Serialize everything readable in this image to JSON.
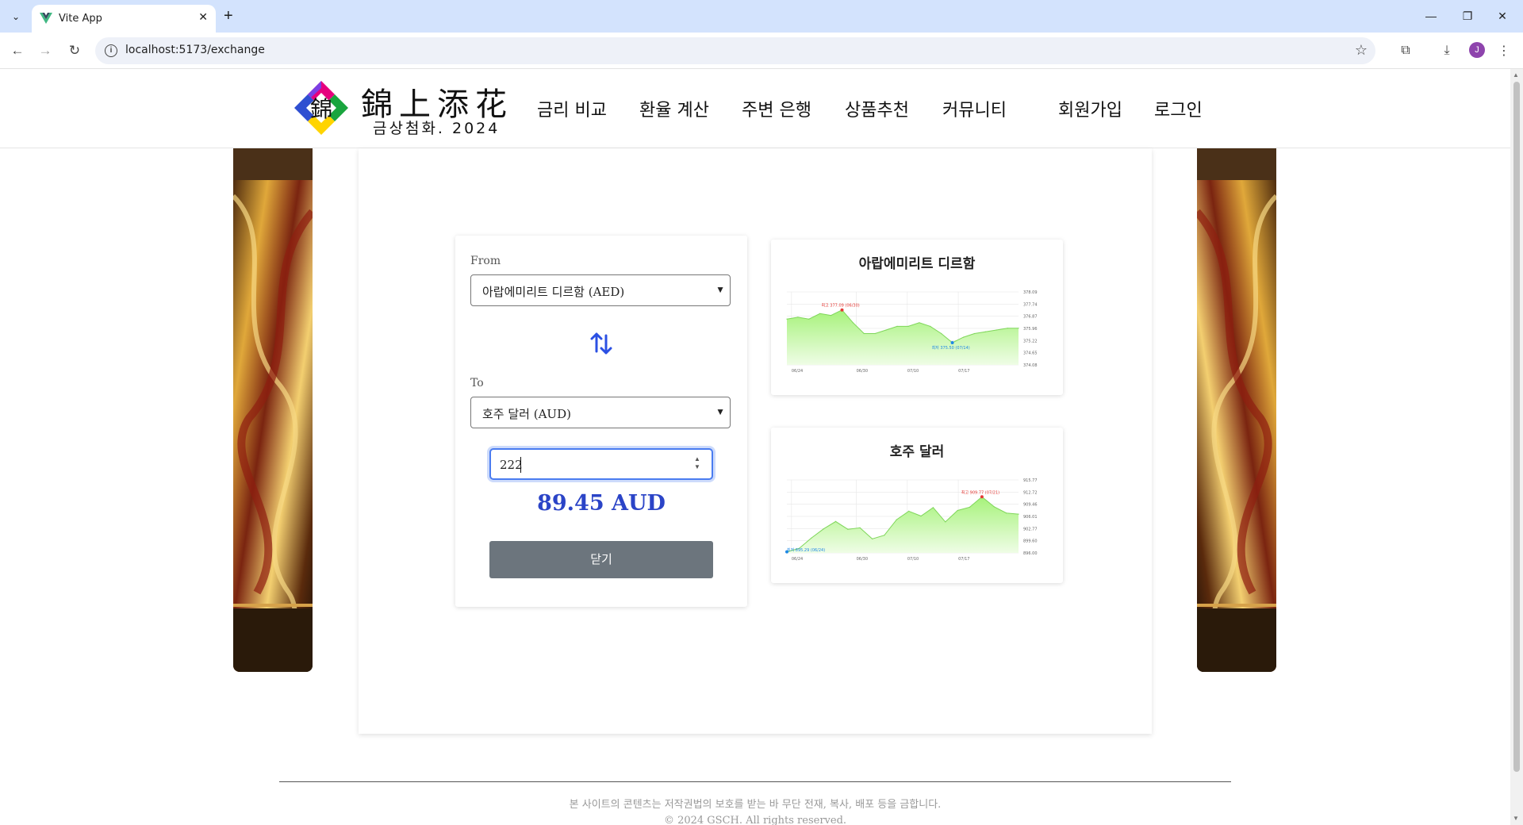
{
  "browser": {
    "tab_title": "Vite App",
    "url": "localhost:5173/exchange",
    "profile_initial": "J"
  },
  "site": {
    "brand_main": "錦上添花",
    "brand_sub": "금상첨화. 2024",
    "logo_char": "錦",
    "nav": [
      "금리 비교",
      "환율 계산",
      "주변 은행",
      "상품추천",
      "커뮤니티"
    ],
    "auth": [
      "회원가입",
      "로그인"
    ]
  },
  "converter": {
    "from_label": "From",
    "from_value": "아랍에미리트 디르함 (AED)",
    "to_label": "To",
    "to_value": "호주 달러 (AUD)",
    "amount": "222",
    "result": "89.45 AUD",
    "close_label": "닫기"
  },
  "charts": {
    "from_title": "아랍에미리트 디르함",
    "to_title": "호주 달러"
  },
  "chart_data": [
    {
      "type": "area",
      "title": "아랍에미리트 디르함",
      "x_ticks": [
        "06/24",
        "06/30",
        "07/10",
        "07/17"
      ],
      "y_ticks": [
        "378.09",
        "377.74",
        "376.87",
        "375.96",
        "375.22",
        "374.65",
        "374.08"
      ],
      "annotations": [
        "최고 377.09 (06/30)",
        "최저 375.50 (07/14)"
      ],
      "ylim": [
        374.08,
        378.09
      ],
      "series": [
        {
          "values": [
            376.6,
            376.7,
            376.6,
            376.9,
            376.8,
            377.1,
            376.4,
            375.8,
            375.8,
            376.0,
            376.2,
            376.2,
            376.4,
            376.2,
            375.8,
            375.3,
            375.6,
            375.8,
            375.9,
            376.0,
            376.1,
            376.1
          ]
        }
      ]
    },
    {
      "type": "area",
      "title": "호주 달러",
      "x_ticks": [
        "06/24",
        "06/30",
        "07/10",
        "07/17"
      ],
      "y_ticks": [
        "915.77",
        "912.72",
        "909.46",
        "906.01",
        "902.77",
        "899.60",
        "896.00"
      ],
      "annotations": [
        "최고 909.77 (07/21)",
        "최저 895.29 (06/24)"
      ],
      "ylim": [
        896.0,
        915.77
      ],
      "series": [
        {
          "values": [
            896.3,
            897.2,
            900.0,
            902.5,
            904.5,
            902.4,
            902.8,
            899.8,
            900.8,
            905.0,
            907.3,
            906.0,
            908.3,
            904.4,
            907.5,
            908.4,
            911.2,
            908.5,
            906.8,
            906.5
          ]
        }
      ]
    }
  ],
  "footer": {
    "notice": "본 사이트의 콘텐츠는 저작권법의 보호를 받는 바 무단 전재, 복사, 배포 등을 금합니다.",
    "copyright": "© 2024 GSCH. All rights reserved."
  }
}
